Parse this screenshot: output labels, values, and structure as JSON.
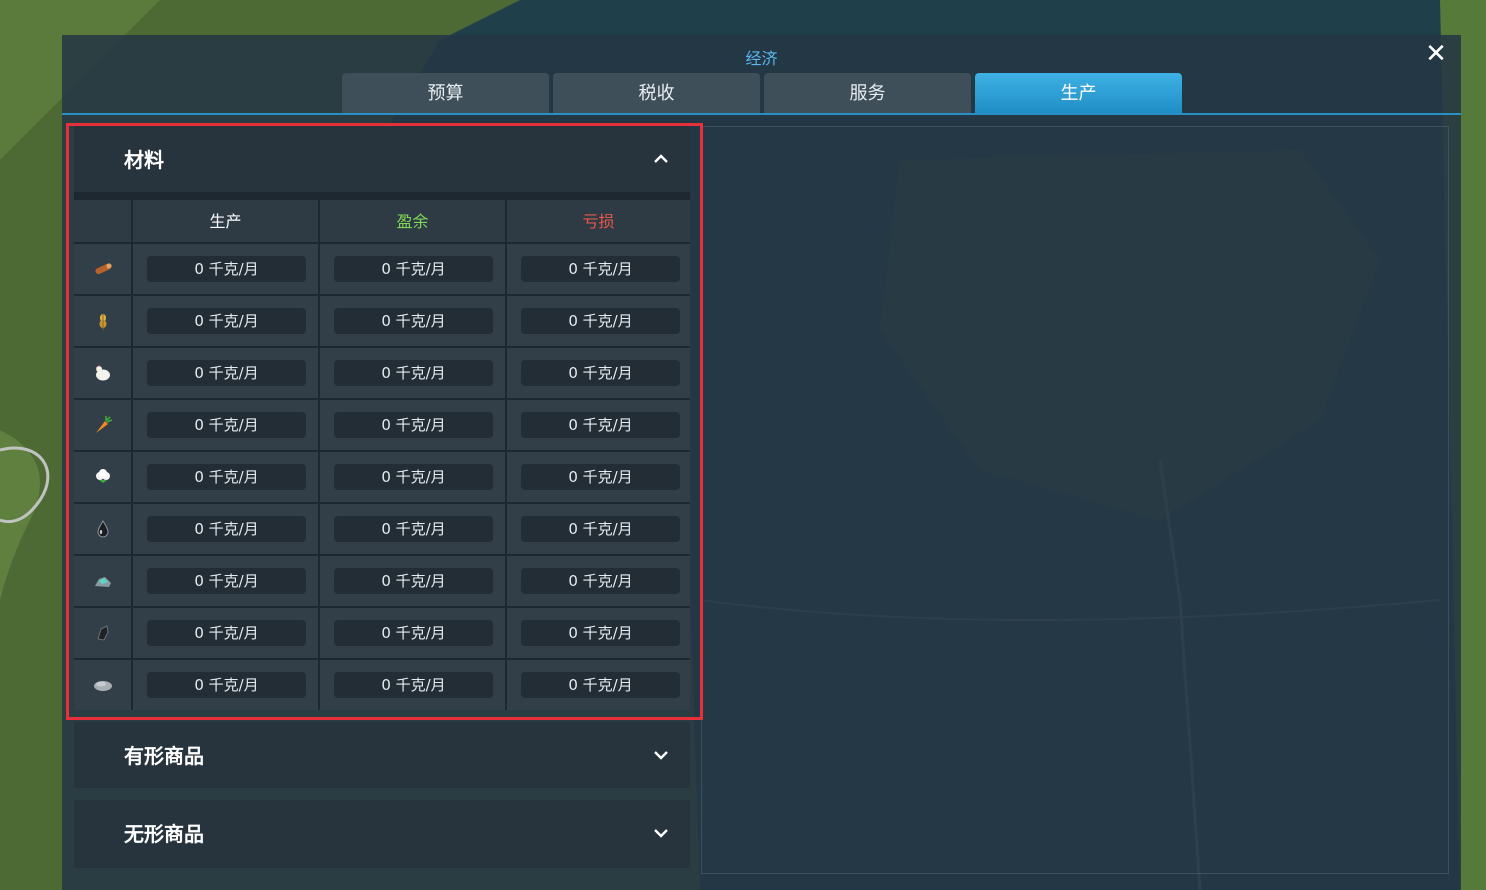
{
  "window": {
    "title": "经济",
    "close_label": "✕"
  },
  "tabs": [
    {
      "label": "预算",
      "active": false
    },
    {
      "label": "税收",
      "active": false
    },
    {
      "label": "服务",
      "active": false
    },
    {
      "label": "生产",
      "active": true
    }
  ],
  "colors": {
    "accent": "#3fb1e4",
    "surplus": "#7ed957",
    "deficit": "#e8584d",
    "highlight": "#e8303a"
  },
  "sections": {
    "materials": {
      "title": "材料",
      "expanded": true,
      "columns": {
        "production": "生产",
        "surplus": "盈余",
        "deficit": "亏损"
      },
      "rows": [
        {
          "icon": "wood-log-icon",
          "production": "0 千克/月",
          "surplus": "0 千克/月",
          "deficit": "0 千克/月"
        },
        {
          "icon": "grain-icon",
          "production": "0 千克/月",
          "surplus": "0 千克/月",
          "deficit": "0 千克/月"
        },
        {
          "icon": "livestock-chicken-icon",
          "production": "0 千克/月",
          "surplus": "0 千克/月",
          "deficit": "0 千克/月"
        },
        {
          "icon": "vegetables-carrot-icon",
          "production": "0 千克/月",
          "surplus": "0 千克/月",
          "deficit": "0 千克/月"
        },
        {
          "icon": "cotton-icon",
          "production": "0 千克/月",
          "surplus": "0 千克/月",
          "deficit": "0 千克/月"
        },
        {
          "icon": "oil-drop-icon",
          "production": "0 千克/月",
          "surplus": "0 千克/月",
          "deficit": "0 千克/月"
        },
        {
          "icon": "ore-icon",
          "production": "0 千克/月",
          "surplus": "0 千克/月",
          "deficit": "0 千克/月"
        },
        {
          "icon": "coal-icon",
          "production": "0 千克/月",
          "surplus": "0 千克/月",
          "deficit": "0 千克/月"
        },
        {
          "icon": "stone-icon",
          "production": "0 千克/月",
          "surplus": "0 千克/月",
          "deficit": "0 千克/月"
        }
      ]
    },
    "tangible_goods": {
      "title": "有形商品",
      "expanded": false
    },
    "intangible_goods": {
      "title": "无形商品",
      "expanded": false
    }
  }
}
